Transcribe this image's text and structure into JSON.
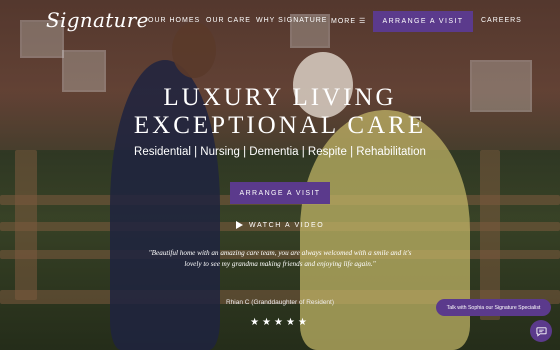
{
  "brand": {
    "logo_text": "Signature"
  },
  "nav": {
    "items": [
      "OUR HOMES",
      "OUR CARE",
      "WHY SIGNATURE",
      "MORE ☰"
    ],
    "cta_label": "ARRANGE A VISIT",
    "careers_label": "CAREERS"
  },
  "hero": {
    "headline_line1": "LUXURY LIVING",
    "headline_line2": "EXCEPTIONAL CARE",
    "services": "Residential | Nursing | Dementia | Respite | Rehabilitation",
    "cta_label": "ARRANGE A VISIT",
    "video_label": "WATCH A VIDEO"
  },
  "testimonial": {
    "quote": "\"Beautiful home with an amazing care team, you are always welcomed with a smile and it's lovely to see my grandma making friends and enjoying life again.\"",
    "attribution": "Rhian C (Granddaughter of Resident)",
    "stars": "★★★★★"
  },
  "chat": {
    "bubble_text": "Talk with Sophia our Signature Specialist",
    "button_icon": "chat-icon"
  },
  "colors": {
    "accent": "#5b3a8c"
  }
}
